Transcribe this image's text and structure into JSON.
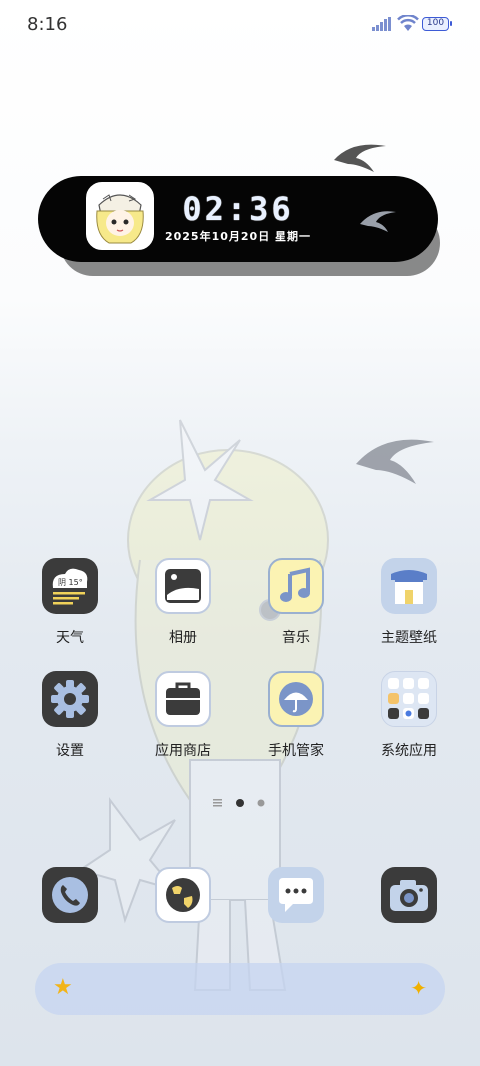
{
  "status": {
    "time": "8:16",
    "battery": "100"
  },
  "clock": {
    "time": "02:36",
    "date": "2025年10月20日 星期一"
  },
  "weather_tile": {
    "text": "阴 15°"
  },
  "apps": [
    {
      "label": "天气"
    },
    {
      "label": "相册"
    },
    {
      "label": "音乐"
    },
    {
      "label": "主题壁纸"
    },
    {
      "label": "设置"
    },
    {
      "label": "应用商店"
    },
    {
      "label": "手机管家"
    },
    {
      "label": "系统应用"
    }
  ],
  "dock": [
    "phone-icon",
    "browser-icon",
    "messages-icon",
    "camera-icon"
  ],
  "colors": {
    "widget_bg": "#050505",
    "dark_tile": "#3a3a3a",
    "yellow_tile": "#fbf3b3",
    "blue_tile": "#c3d3ea"
  }
}
